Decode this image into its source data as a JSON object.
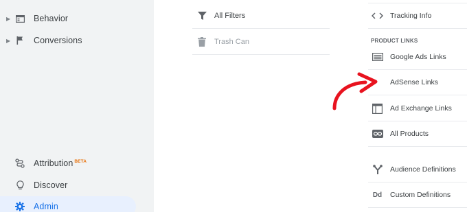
{
  "sidebar": {
    "items": [
      {
        "label": "Behavior",
        "icon": "behavior-icon",
        "expandable": true
      },
      {
        "label": "Conversions",
        "icon": "flag-icon",
        "expandable": true
      }
    ],
    "bottom": [
      {
        "label": "Attribution",
        "badge": "BETA",
        "icon": "attribution-icon"
      },
      {
        "label": "Discover",
        "icon": "lightbulb-icon"
      },
      {
        "label": "Admin",
        "icon": "gear-icon",
        "active": true
      }
    ]
  },
  "view_column": {
    "items": [
      {
        "label": "All Filters",
        "icon": "filter-icon",
        "enabled": true
      },
      {
        "label": "Trash Can",
        "icon": "trash-icon",
        "enabled": false
      }
    ]
  },
  "property_column": {
    "items_top": [
      {
        "label": "Tracking Info",
        "icon": "code-icon"
      }
    ],
    "section_title": "PRODUCT LINKS",
    "product_links": [
      {
        "label": "Google Ads Links",
        "icon": "google-ads-icon"
      },
      {
        "label": "AdSense Links",
        "icon": "adsense-icon"
      },
      {
        "label": "Ad Exchange Links",
        "icon": "ad-exchange-icon"
      },
      {
        "label": "All Products",
        "icon": "link-icon"
      }
    ],
    "items_bottom": [
      {
        "label": "Audience Definitions",
        "icon": "audience-icon"
      },
      {
        "label": "Custom Definitions",
        "icon": "dd-icon",
        "icon_text": "Dd"
      }
    ]
  },
  "annotation": {
    "color": "#e8131f",
    "points_to": "AdSense Links"
  },
  "colors": {
    "accent": "#1a73e8",
    "sidebar_bg": "#f1f3f4",
    "active_bg": "#e8f0fe",
    "beta": "#e8710a"
  }
}
